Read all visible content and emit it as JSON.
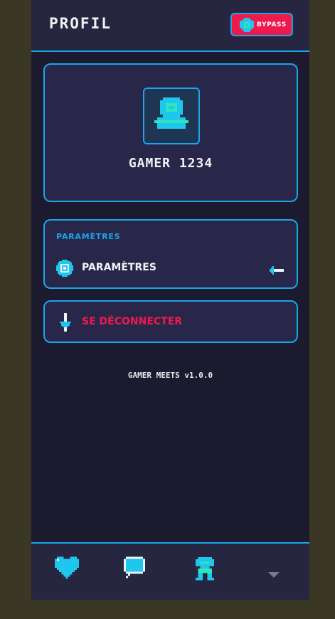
{
  "header": {
    "title": "PROFIL",
    "bypass_label": "BYPASS",
    "bypass_icon": "gem-icon"
  },
  "profile": {
    "avatar_icon": "user-avatar-icon",
    "username": "GAMER 1234"
  },
  "settings": {
    "section_heading": "PARAMÈTRES",
    "items": [
      {
        "label": "PARAMÈTRES",
        "icon": "gear-icon",
        "trailing_icon": "arrow-left-icon"
      }
    ]
  },
  "logout": {
    "label": "SE DÉCONNECTER",
    "icon": "sword-icon"
  },
  "footer": {
    "version": "GAMER MEETS v1.0.0"
  },
  "bottom_nav": {
    "items": [
      {
        "icon": "heart-icon"
      },
      {
        "icon": "chat-bubble-icon"
      },
      {
        "icon": "profile-icon",
        "active": true
      },
      {
        "icon": "chevron-down-icon"
      }
    ]
  },
  "colors": {
    "accent": "#1aa6e8",
    "danger": "#ee1a4c",
    "background": "#1b1a2f",
    "surface": "#28274a",
    "pixel_cyan": "#1fc6ee",
    "pixel_green": "#2ee6b8"
  }
}
